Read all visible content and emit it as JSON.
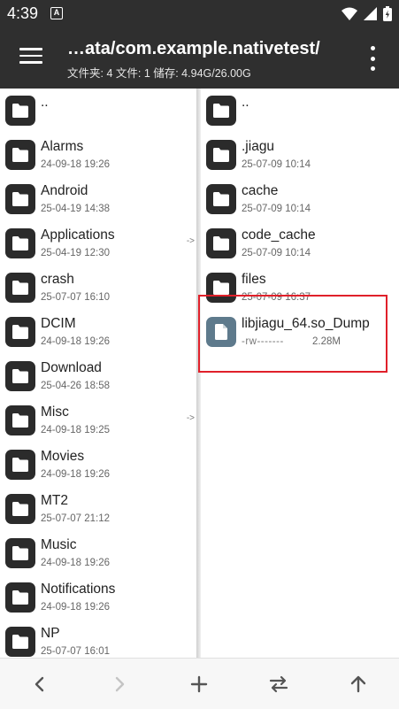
{
  "status": {
    "time": "4:39",
    "notif_letter": "A"
  },
  "header": {
    "path": "…ata/com.example.nativetest/",
    "info": "文件夹: 4  文件: 1  储存: 4.94G/26.00G"
  },
  "left_pane": {
    "items": [
      {
        "name": "..",
        "date": ""
      },
      {
        "name": "Alarms",
        "date": "24-09-18 19:26"
      },
      {
        "name": "Android",
        "date": "25-04-19 14:38"
      },
      {
        "name": "Applications",
        "date": "25-04-19 12:30",
        "link": "->"
      },
      {
        "name": "crash",
        "date": "25-07-07 16:10"
      },
      {
        "name": "DCIM",
        "date": "24-09-18 19:26"
      },
      {
        "name": "Download",
        "date": "25-04-26 18:58"
      },
      {
        "name": "Misc",
        "date": "24-09-18 19:25",
        "link": "->"
      },
      {
        "name": "Movies",
        "date": "24-09-18 19:26"
      },
      {
        "name": "MT2",
        "date": "25-07-07 21:12"
      },
      {
        "name": "Music",
        "date": "24-09-18 19:26"
      },
      {
        "name": "Notifications",
        "date": "24-09-18 19:26"
      },
      {
        "name": "NP",
        "date": "25-07-07 16:01"
      }
    ]
  },
  "right_pane": {
    "items": [
      {
        "name": "..",
        "date": ""
      },
      {
        "name": ".jiagu",
        "date": "25-07-09 10:14"
      },
      {
        "name": "cache",
        "date": "25-07-09 10:14"
      },
      {
        "name": "code_cache",
        "date": "25-07-09 10:14"
      },
      {
        "name": "files",
        "date": "25-07-09 16:37"
      }
    ],
    "file": {
      "name": "libjiagu_64.so_Dump",
      "perm": "-rw-------",
      "size": "2.28M"
    }
  },
  "bottom_nav": [
    "back-arrow-icon",
    "forward-arrow-icon",
    "add-icon",
    "swap-icon",
    "up-arrow-icon"
  ],
  "colors": {
    "bar": "#2f2f2f",
    "folder": "#2b2b2b",
    "file": "#5e7a8c",
    "highlight": "#e0202a"
  }
}
